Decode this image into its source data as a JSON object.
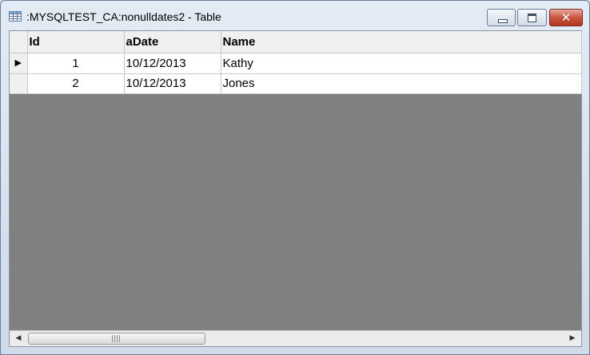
{
  "window": {
    "title": ":MYSQLTEST_CA:nonulldates2 - Table",
    "icon": "table-grid-icon",
    "controls": {
      "minimize": "minimize-icon",
      "maximize": "maximize-icon",
      "close": "close-icon",
      "close_glyph": "✕"
    }
  },
  "grid": {
    "columns": [
      "Id",
      "aDate",
      "Name"
    ],
    "current_row_indicator": "▶",
    "rows": [
      {
        "id": "1",
        "aDate": "10/12/2013",
        "name": "Kathy"
      },
      {
        "id": "2",
        "aDate": "10/12/2013",
        "name": "Jones"
      }
    ]
  },
  "scrollbar": {
    "left_arrow": "◀",
    "right_arrow": "▶"
  },
  "colors": {
    "empty_area": "#808080",
    "header_bg": "#f0f0f0",
    "close_button": "#c75640"
  }
}
